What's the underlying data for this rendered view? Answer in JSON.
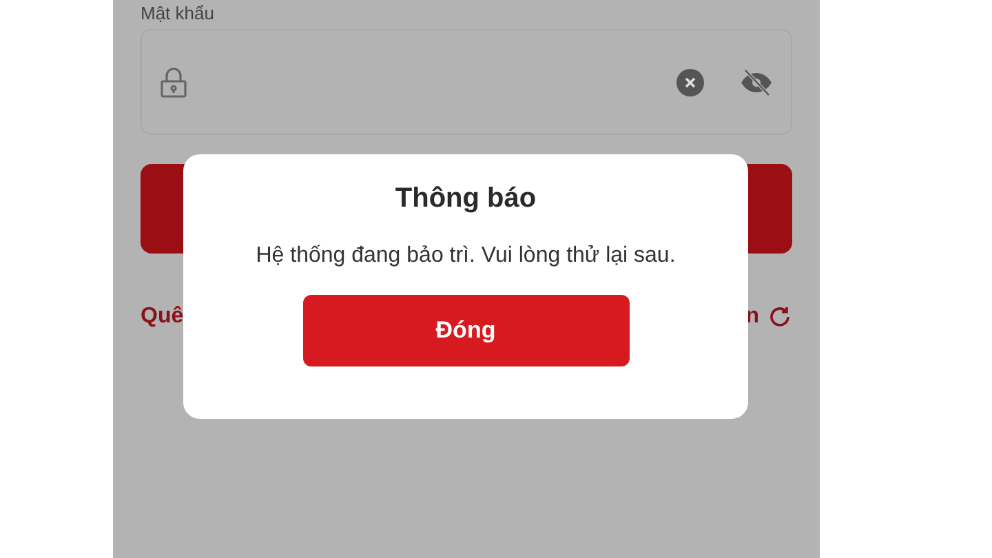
{
  "password_field": {
    "label": "Mật khẩu"
  },
  "footer_links": {
    "left": "Quê",
    "right": "n"
  },
  "dialog": {
    "title": "Thông báo",
    "message": "Hệ thống đang bảo trì. Vui lòng thử lại sau.",
    "button": "Đóng"
  }
}
